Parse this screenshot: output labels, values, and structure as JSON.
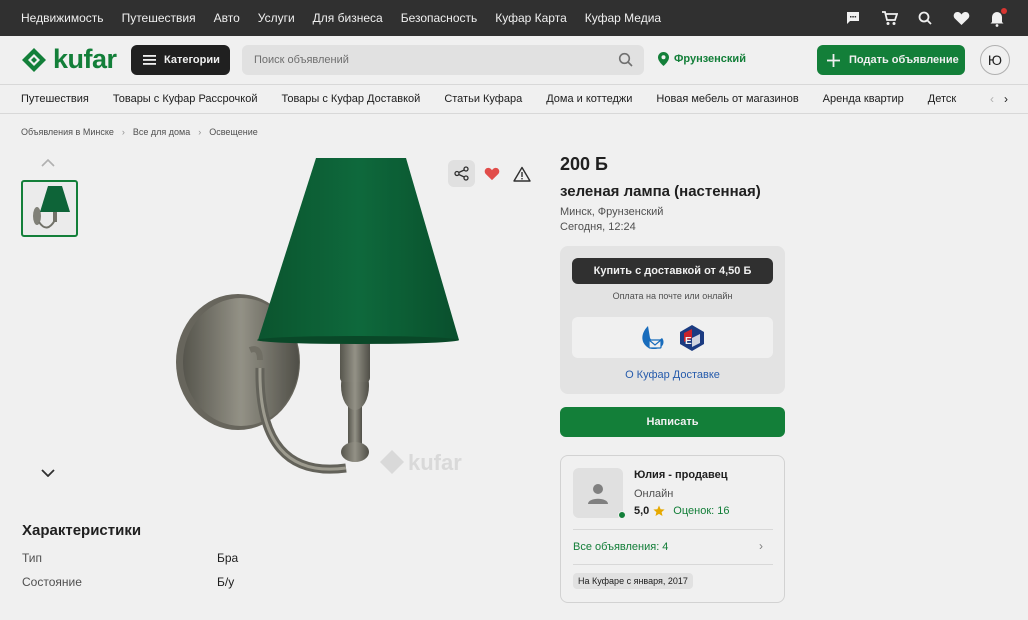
{
  "topbar": {
    "links": [
      "Недвижимость",
      "Путешествия",
      "Авто",
      "Услуги",
      "Для бизнеса",
      "Безопасность",
      "Куфар Карта",
      "Куфар Медиа"
    ],
    "icons": [
      "messages-icon",
      "cart-icon",
      "search-saved-icon",
      "favorites-icon",
      "notifications-icon"
    ]
  },
  "header": {
    "logo_text": "kufar",
    "categories_label": "Категории",
    "search_placeholder": "Поиск объявлений",
    "region": "Фрунзенский",
    "post_label": "Подать объявление",
    "avatar_letter": "Ю"
  },
  "categories": [
    "Путешествия",
    "Товары с Куфар Рассрочкой",
    "Товары с Куфар Доставкой",
    "Статьи Куфара",
    "Дома и коттеджи",
    "Новая мебель от магазинов",
    "Аренда квартир",
    "Детск"
  ],
  "breadcrumb": [
    "Объявления в Минске",
    "Все для дома",
    "Освещение"
  ],
  "listing": {
    "price": "200 Б",
    "title": "зеленая лампа (настенная)",
    "location": "Минск, Фрунзенский",
    "date": "Сегодня, 12:24",
    "image_watermark": "kufar"
  },
  "delivery": {
    "buy_label": "Купить с доставкой от 4,50 Б",
    "note": "Оплата на почте или онлайн",
    "link": "О Куфар Доставке"
  },
  "write_label": "Написать",
  "seller": {
    "name": "Юлия - продавец",
    "status": "Онлайн",
    "rating": "5,0",
    "reviews": "Оценок: 16",
    "all_ads": "Все объявления: 4",
    "since": "На Куфаре с января, 2017"
  },
  "characteristics": {
    "title": "Характеристики",
    "rows": [
      {
        "key": "Тип",
        "value": "Бра"
      },
      {
        "key": "Состояние",
        "value": "Б/у"
      }
    ]
  },
  "colors": {
    "brand_green": "#15873d",
    "dark": "#333333",
    "link_blue": "#2a62b7",
    "lamp_shade": "#0f6b3c",
    "heart": "#f0524f"
  }
}
